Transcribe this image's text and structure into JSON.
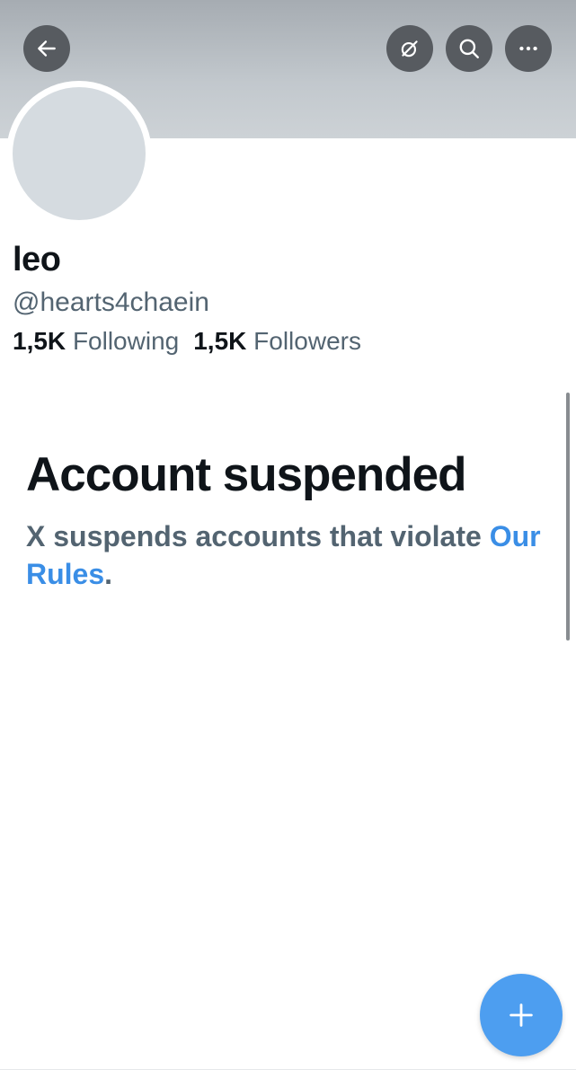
{
  "header": {
    "back_icon": "arrow-left-icon",
    "grok_icon": "grok-icon",
    "search_icon": "search-icon",
    "more_icon": "more-horizontal-icon"
  },
  "profile": {
    "name": "leo",
    "handle": "@hearts4chaein",
    "following_count": "1,5K",
    "following_label": "Following",
    "followers_count": "1,5K",
    "followers_label": "Followers"
  },
  "suspension": {
    "title": "Account suspended",
    "message": "X suspends accounts that violate",
    "rules_link": "Our Rules",
    "period": "."
  },
  "fab": {
    "icon": "plus-icon"
  },
  "colors": {
    "accent": "#4d9ef0",
    "link": "#3a8ee6",
    "secondary_text": "#536471",
    "primary_text": "#0f1419",
    "avatar_placeholder": "#d5dbe0"
  }
}
